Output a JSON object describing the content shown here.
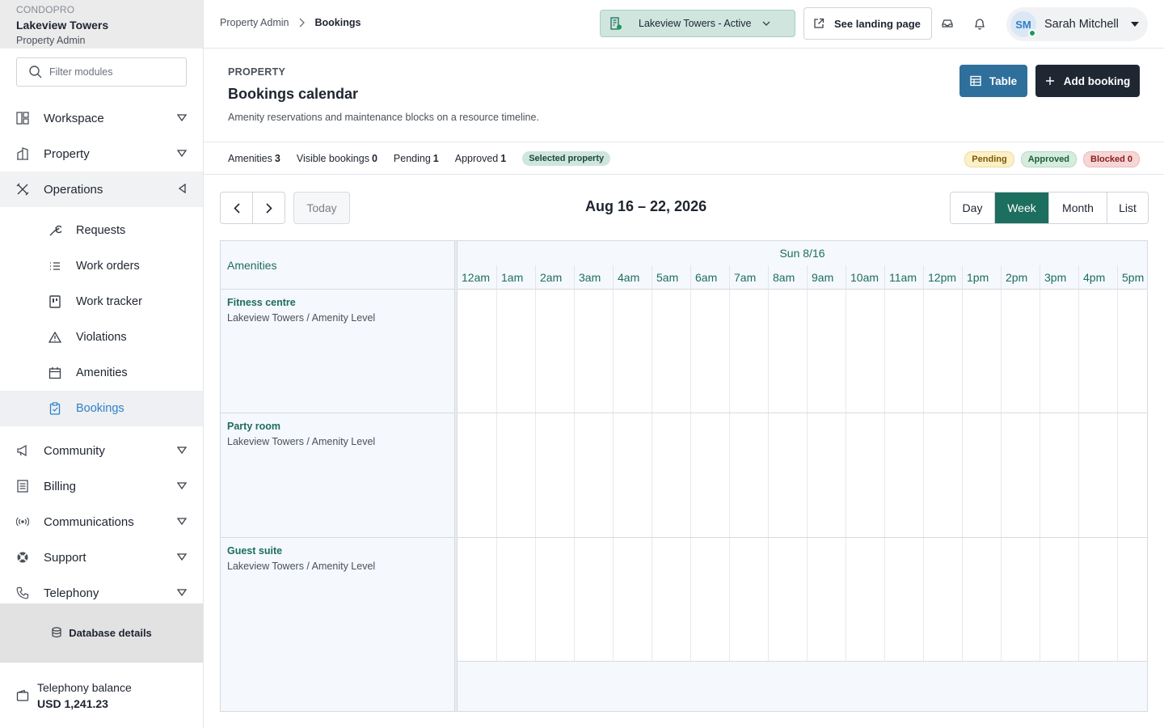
{
  "brand": {
    "app": "CONDOPRO",
    "property": "Lakeview Towers",
    "role": "Property Admin"
  },
  "sidebar": {
    "filter_placeholder": "Filter modules",
    "items": [
      {
        "label": "Workspace",
        "icon": "workspace-icon"
      },
      {
        "label": "Property",
        "icon": "building-icon"
      },
      {
        "label": "Operations",
        "icon": "tools-icon"
      },
      {
        "label": "Community",
        "icon": "megaphone-icon"
      },
      {
        "label": "Billing",
        "icon": "billing-icon"
      },
      {
        "label": "Communications",
        "icon": "broadcast-icon"
      },
      {
        "label": "Support",
        "icon": "lifebuoy-icon"
      },
      {
        "label": "Telephony",
        "icon": "phone-icon"
      }
    ],
    "sub_items": [
      {
        "label": "Requests",
        "icon": "wrench-icon"
      },
      {
        "label": "Work orders",
        "icon": "list-icon"
      },
      {
        "label": "Work tracker",
        "icon": "tracker-icon"
      },
      {
        "label": "Violations",
        "icon": "warning-icon"
      },
      {
        "label": "Amenities",
        "icon": "calendar-icon"
      },
      {
        "label": "Bookings",
        "icon": "clipboard-icon"
      }
    ],
    "database_label": "Database details",
    "balance_label": "Telephony balance",
    "balance_value": "USD 1,241.23"
  },
  "topbar": {
    "breadcrumb": [
      "Property Admin",
      "Bookings"
    ],
    "property_select": "Lakeview Towers - Active",
    "landing_label": "See landing page",
    "user_initials": "SM",
    "user_name": "Sarah Mitchell"
  },
  "header": {
    "kicker": "PROPERTY",
    "title": "Bookings calendar",
    "description": "Amenity reservations and maintenance blocks on a resource timeline.",
    "table_label": "Table",
    "add_label": "Add booking"
  },
  "stats": {
    "amenities_label": "Amenities",
    "amenities_value": "3",
    "visible_label": "Visible bookings",
    "visible_value": "0",
    "pending_label": "Pending",
    "pending_value": "1",
    "approved_label": "Approved",
    "approved_value": "1",
    "selected_chip": "Selected property",
    "legend": {
      "pending": "Pending",
      "approved": "Approved",
      "blocked": "Blocked 0"
    }
  },
  "calendar": {
    "today_label": "Today",
    "range": "Aug 16 – 22, 2026",
    "views": [
      "Day",
      "Week",
      "Month",
      "List"
    ],
    "active_view": "Week",
    "resource_header": "Amenities",
    "day_header": "Sun 8/16",
    "hours": [
      "12am",
      "1am",
      "2am",
      "3am",
      "4am",
      "5am",
      "6am",
      "7am",
      "8am",
      "9am",
      "10am",
      "11am",
      "12pm",
      "1pm",
      "2pm",
      "3pm",
      "4pm",
      "5pm"
    ],
    "resources": [
      {
        "name": "Fitness centre",
        "location": "Lakeview Towers / Amenity Level"
      },
      {
        "name": "Party room",
        "location": "Lakeview Towers / Amenity Level"
      },
      {
        "name": "Guest suite",
        "location": "Lakeview Towers / Amenity Level"
      }
    ]
  },
  "colors": {
    "accent": "#1c6e5e",
    "table_button": "#2e6f9c",
    "add_button": "#1f2733",
    "active_link": "#2f7fc7"
  }
}
